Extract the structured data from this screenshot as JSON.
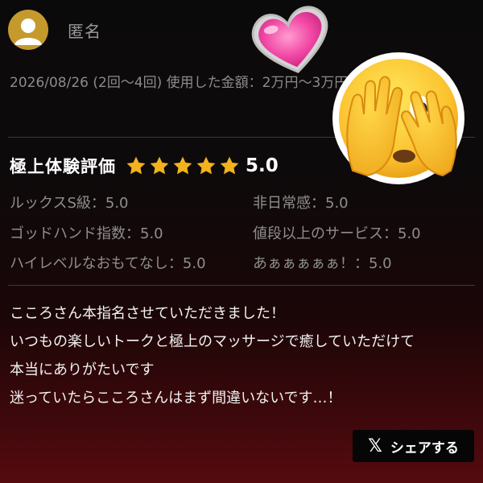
{
  "user": {
    "name": "匿名",
    "avatar_icon": "user-icon"
  },
  "meta": {
    "text": "2026/08/26 (2回〜4回) 使用した金額：2万円〜3万円以内"
  },
  "rating": {
    "title": "極上体験評価",
    "stars": 5,
    "value": "5.0"
  },
  "scores": [
    {
      "label": "ルックスS級：5.0"
    },
    {
      "label": "非日常感：5.0"
    },
    {
      "label": "ゴッドハンド指数：5.0"
    },
    {
      "label": "値段以上のサービス：5.0"
    },
    {
      "label": "ハイレベルなおもてなし：5.0"
    },
    {
      "label": "あぁぁぁぁぁ！：5.0"
    }
  ],
  "comment": {
    "lines": [
      "こころさん本指名させていただきました！",
      "いつもの楽しいトークと極上のマッサージで癒していただけて",
      "本当にありがたいです",
      "迷っていたらこころさんはまず間違いないです…！"
    ]
  },
  "share": {
    "icon": "x-logo-icon",
    "label": "シェアする"
  },
  "overlays": {
    "heart_icon": "sparkling-heart-icon",
    "face_icon": "peeking-face-icon"
  },
  "colors": {
    "star": "#f2b21e",
    "avatar": "#c59a2c",
    "background_bottom": "#560b0f"
  }
}
